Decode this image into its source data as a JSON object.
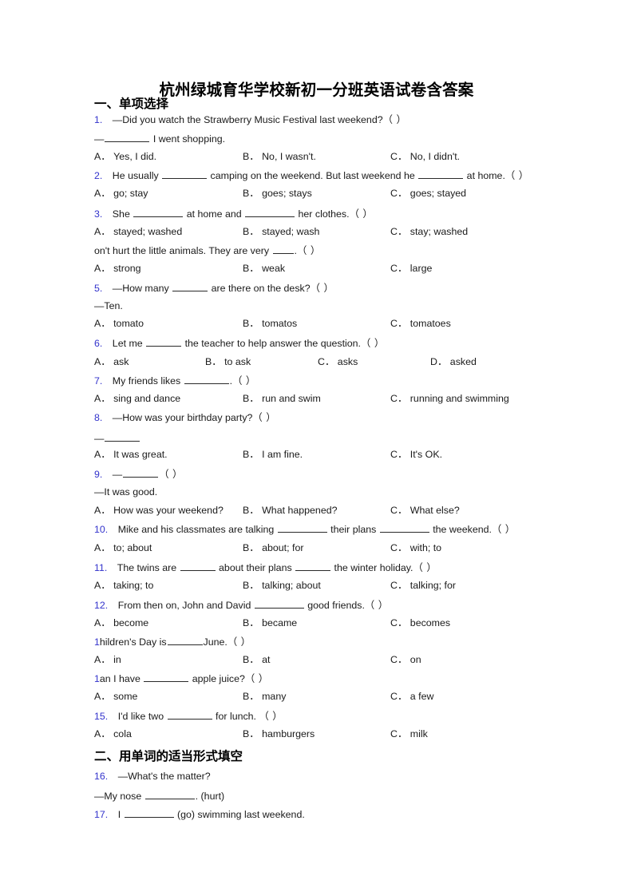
{
  "document": {
    "title": "杭州绿城育华学校新初一分班英语试卷含答案",
    "accent_color": "#3333cc",
    "text_color": "#1a1a1a",
    "background": "#ffffff"
  },
  "sections": [
    {
      "id": "section-1",
      "heading": "一、单项选择"
    },
    {
      "id": "section-2",
      "heading": "二、用单词的适当形式填空"
    }
  ],
  "questions": [
    {
      "number": "1.",
      "stem": "—Did you watch the Strawberry Music Festival last weekend?（  ）",
      "stem_extra": "—______ I went shopping.",
      "options": [
        {
          "label": "A．",
          "text": "Yes, I did."
        },
        {
          "label": "B．",
          "text": "No, I wasn't."
        },
        {
          "label": "C．",
          "text": "No, I didn't."
        }
      ]
    },
    {
      "number": "2.",
      "stem": "He usually ______ camping on the weekend. But last weekend he ______ at home.（  ）",
      "options": [
        {
          "label": "A．",
          "text": "go; stay"
        },
        {
          "label": "B．",
          "text": "goes; stays"
        },
        {
          "label": "C．",
          "text": "goes; stayed"
        }
      ]
    },
    {
      "number": "3.",
      "stem": "She ________ at home and ________ her clothes.（  ）",
      "options": [
        {
          "label": "A．",
          "text": "stayed; washed"
        },
        {
          "label": "B．",
          "text": "stayed; wash"
        },
        {
          "label": "C．",
          "text": "stay; washed"
        }
      ]
    },
    {
      "number": "",
      "stem": "on't hurt the little animals. They are very ___.（  ）",
      "options": [
        {
          "label": "A．",
          "text": "strong"
        },
        {
          "label": "B．",
          "text": "weak"
        },
        {
          "label": "C．",
          "text": "large"
        }
      ]
    },
    {
      "number": "5.",
      "stem": "—How many _____ are there on the desk?（ ）",
      "stem_extra": "—Ten.",
      "options": [
        {
          "label": "A．",
          "text": "tomato"
        },
        {
          "label": "B．",
          "text": "tomatos"
        },
        {
          "label": "C．",
          "text": "tomatoes"
        }
      ]
    },
    {
      "number": "6.",
      "stem": "Let me _____ the teacher to help answer the question.（ ）",
      "options": [
        {
          "label": "A．",
          "text": "ask"
        },
        {
          "label": "B．",
          "text": "to ask"
        },
        {
          "label": "C．",
          "text": "asks"
        },
        {
          "label": "D．",
          "text": "asked"
        }
      ]
    },
    {
      "number": "7.",
      "stem": "My friends likes ______.（ ）",
      "options": [
        {
          "label": "A．",
          "text": "sing and dance"
        },
        {
          "label": "B．",
          "text": "run and swim"
        },
        {
          "label": "C．",
          "text": "running and swimming"
        }
      ]
    },
    {
      "number": "8.",
      "stem": "—How was your birthday party?（  ）",
      "stem_extra": "—______",
      "options": [
        {
          "label": "A．",
          "text": "It was great."
        },
        {
          "label": "B．",
          "text": "I am fine."
        },
        {
          "label": "C．",
          "text": "It's OK."
        }
      ]
    },
    {
      "number": "9.",
      "stem": "—_____（ ）",
      "stem_extra": "—It was good.",
      "options": [
        {
          "label": "A．",
          "text": "How was your weekend?"
        },
        {
          "label": "B．",
          "text": "What happened?"
        },
        {
          "label": "C．",
          "text": "What else?"
        }
      ]
    },
    {
      "number": "10.",
      "stem": "Mike and his classmates are talking ________ their plans ________ the weekend.（  ）",
      "options": [
        {
          "label": "A．",
          "text": "to; about"
        },
        {
          "label": "B．",
          "text": "about; for"
        },
        {
          "label": "C．",
          "text": "with; to"
        }
      ]
    },
    {
      "number": "11.",
      "stem": "The twins are _____ about their plans _____ the winter holiday.（ ）",
      "options": [
        {
          "label": "A．",
          "text": "taking; to"
        },
        {
          "label": "B．",
          "text": "talking; about"
        },
        {
          "label": "C．",
          "text": "talking; for"
        }
      ]
    },
    {
      "number": "12.",
      "stem": "From then on, John and David ________ good friends.（ ）",
      "options": [
        {
          "label": "A．",
          "text": "become"
        },
        {
          "label": "B．",
          "text": "became"
        },
        {
          "label": "C．",
          "text": "becomes"
        }
      ]
    },
    {
      "number": "1",
      "stem": "hildren's Day is_____June.（  ）",
      "options": [
        {
          "label": "A．",
          "text": "in"
        },
        {
          "label": "B．",
          "text": "at"
        },
        {
          "label": "C．",
          "text": "on"
        }
      ]
    },
    {
      "number": "1",
      "stem": "an I have _______ apple juice?（ ）",
      "options": [
        {
          "label": "A．",
          "text": "some"
        },
        {
          "label": "B．",
          "text": "many"
        },
        {
          "label": "C．",
          "text": "a few"
        }
      ]
    },
    {
      "number": "15.",
      "stem": "I'd like two _______ for lunch. （  ）",
      "options": [
        {
          "label": "A．",
          "text": "cola"
        },
        {
          "label": "B．",
          "text": "hamburgers"
        },
        {
          "label": "C．",
          "text": "milk"
        }
      ]
    },
    {
      "number": "16.",
      "stem": "—What's the matter?",
      "stem_extra": "—My nose _________. (hurt)",
      "options": []
    },
    {
      "number": "17.",
      "stem": "I _________ (go) swimming last weekend.",
      "options": []
    }
  ]
}
